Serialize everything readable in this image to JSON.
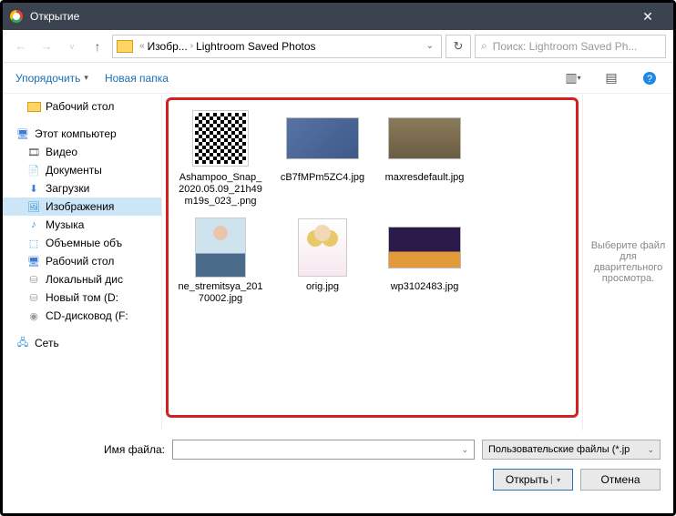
{
  "titlebar": {
    "title": "Открытие"
  },
  "breadcrumb": {
    "seg1": "Изобр...",
    "seg2": "Lightroom Saved Photos"
  },
  "search": {
    "placeholder": "Поиск: Lightroom Saved Ph..."
  },
  "toolbar": {
    "organize": "Упорядочить",
    "newfolder": "Новая папка"
  },
  "sidebar": {
    "desktop": "Рабочий стол",
    "thispc": "Этот компьютер",
    "video": "Видео",
    "documents": "Документы",
    "downloads": "Загрузки",
    "images": "Изображения",
    "music": "Музыка",
    "volumes": "Объемные объ",
    "desktop2": "Рабочий стол",
    "localdisk": "Локальный дис",
    "newvol": "Новый том (D:",
    "cddrive": "CD-дисковод (F:",
    "network": "Сеть"
  },
  "files": [
    {
      "name": "Ashampoo_Snap_2020.05.09_21h49m19s_023_.png"
    },
    {
      "name": "cB7fMPm5ZC4.jpg"
    },
    {
      "name": "maxresdefault.jpg"
    },
    {
      "name": "ne_stremitsya_20170002.jpg"
    },
    {
      "name": "orig.jpg"
    },
    {
      "name": "wp3102483.jpg"
    }
  ],
  "preview": {
    "text": "Выберите файл для дварительного просмотра."
  },
  "bottom": {
    "filename_label": "Имя файла:",
    "filetype": "Пользовательские файлы (*.jp",
    "open": "Открыть",
    "cancel": "Отмена"
  }
}
